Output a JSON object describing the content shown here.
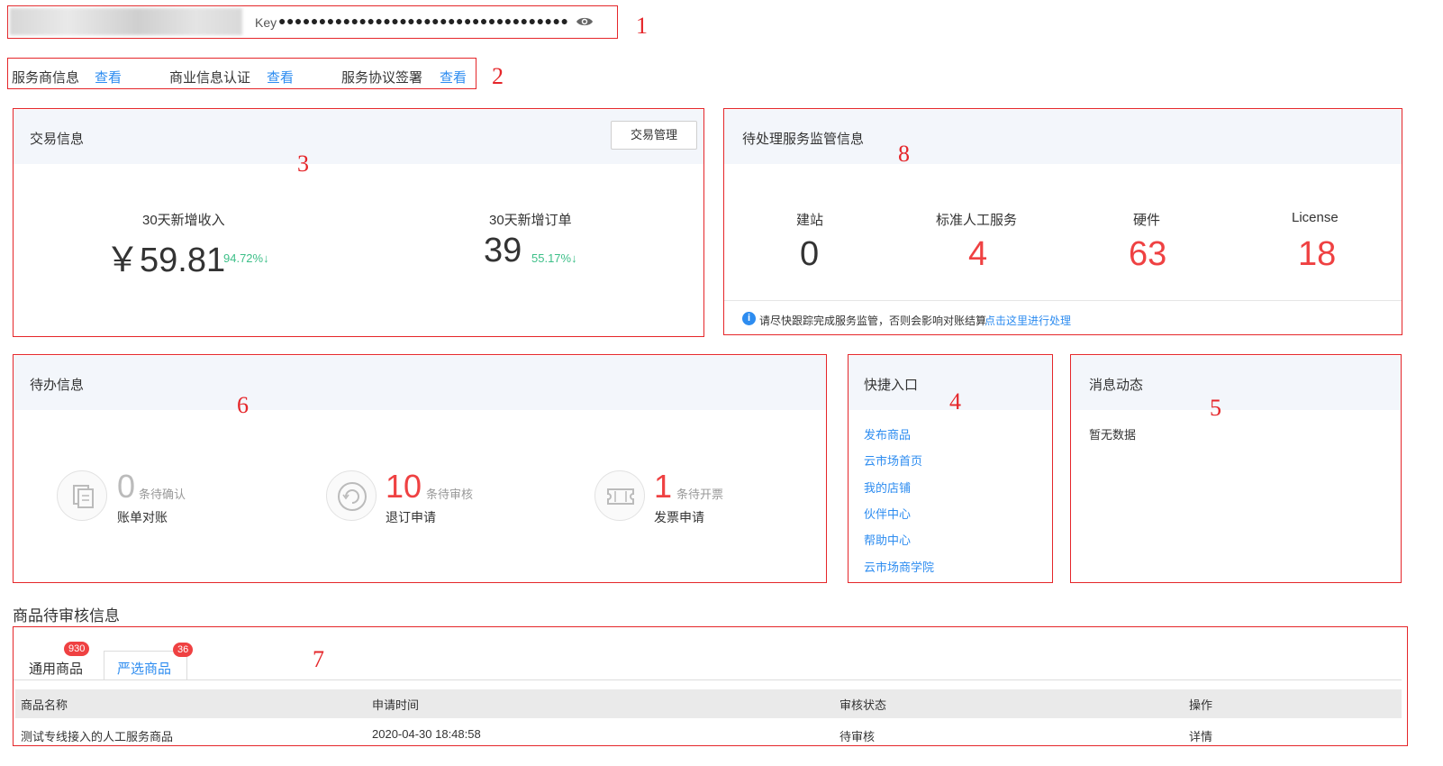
{
  "key_bar": {
    "label": "Key",
    "masked_value": "●●●●●●●●●●●●●●●●●●●●●●●●●●●●●●●●●●●●",
    "annotation": "1"
  },
  "links_bar": {
    "items": [
      {
        "label": "服务商信息",
        "action": "查看"
      },
      {
        "label": "商业信息认证",
        "action": "查看"
      },
      {
        "label": "服务协议签署",
        "action": "查看"
      }
    ],
    "annotation": "2"
  },
  "transaction": {
    "title": "交易信息",
    "manage_button": "交易管理",
    "annotation": "3",
    "income": {
      "label": "30天新增收入",
      "value": "￥59.81",
      "change": "94.72%↓"
    },
    "orders": {
      "label": "30天新增订单",
      "value": "39",
      "change": "55.17%↓"
    }
  },
  "supervision": {
    "title": "待处理服务监管信息",
    "annotation": "8",
    "items": [
      {
        "label": "建站",
        "value": "0"
      },
      {
        "label": "标准人工服务",
        "value": "4"
      },
      {
        "label": "硬件",
        "value": "63"
      },
      {
        "label": "License",
        "value": "18"
      }
    ],
    "notice": "请尽快跟踪完成服务监管，否则会影响对账结算",
    "notice_link": "点击这里进行处理"
  },
  "todo": {
    "title": "待办信息",
    "annotation": "6",
    "items": [
      {
        "count": "0",
        "suffix": "条待确认",
        "label": "账单对账"
      },
      {
        "count": "10",
        "suffix": "条待审核",
        "label": "退订申请"
      },
      {
        "count": "1",
        "suffix": "条待开票",
        "label": "发票申请"
      }
    ]
  },
  "shortcuts": {
    "title": "快捷入口",
    "annotation": "4",
    "links": [
      "发布商品",
      "云市场首页",
      "我的店铺",
      "伙伴中心",
      "帮助中心",
      "云市场商学院"
    ]
  },
  "messages": {
    "title": "消息动态",
    "annotation": "5",
    "empty_text": "暂无数据"
  },
  "review": {
    "section_title": "商品待审核信息",
    "annotation": "7",
    "tabs": [
      {
        "label": "通用商品",
        "badge": "930"
      },
      {
        "label": "严选商品",
        "badge": "36"
      }
    ],
    "columns": [
      "商品名称",
      "申请时间",
      "审核状态",
      "操作"
    ],
    "rows": [
      {
        "name": "测试专线接入的人工服务商品",
        "time": "2020-04-30 18:48:58",
        "status": "待审核",
        "action": "详情"
      }
    ]
  },
  "colors": {
    "accent": "#2d8cf0",
    "alert": "#ef4142",
    "up_down": "#3dbf88",
    "annotation": "#e5262a"
  }
}
